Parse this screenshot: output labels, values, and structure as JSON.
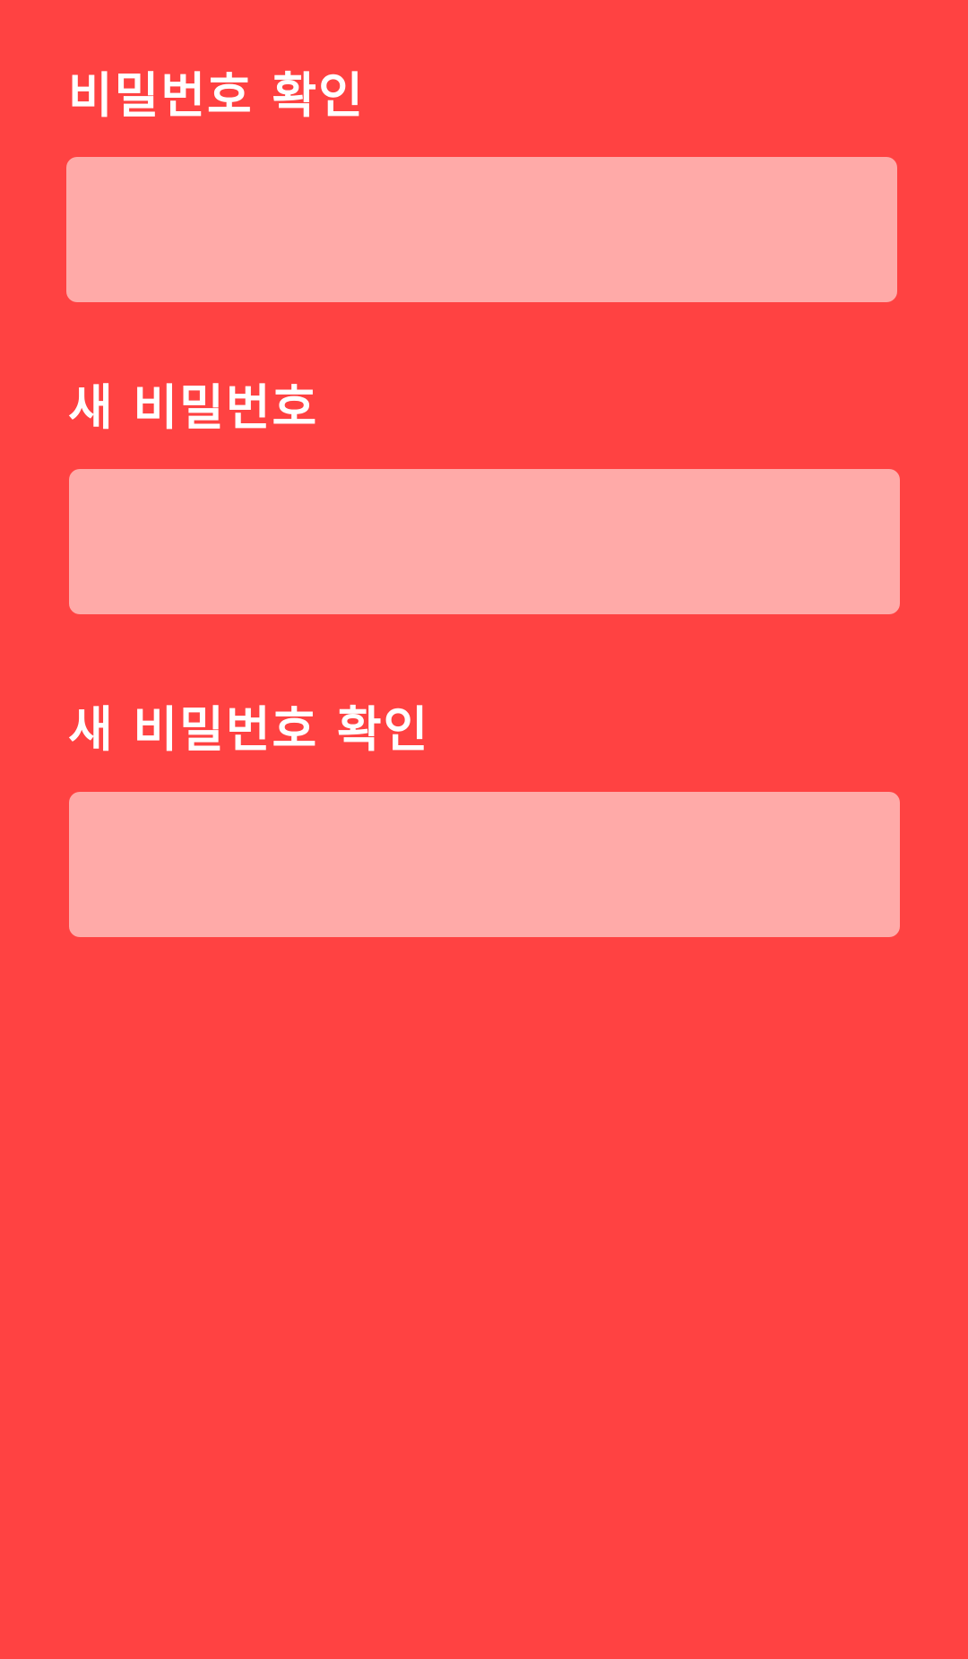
{
  "colors": {
    "background": "#FF4242",
    "input_background": "#FFAAA8",
    "label_text": "#FFFFFF"
  },
  "form": {
    "fields": [
      {
        "label": "비밀번호 확인",
        "value": "",
        "placeholder": ""
      },
      {
        "label": "새 비밀번호",
        "value": "",
        "placeholder": ""
      },
      {
        "label": "새 비밀번호 확인",
        "value": "",
        "placeholder": ""
      }
    ]
  }
}
